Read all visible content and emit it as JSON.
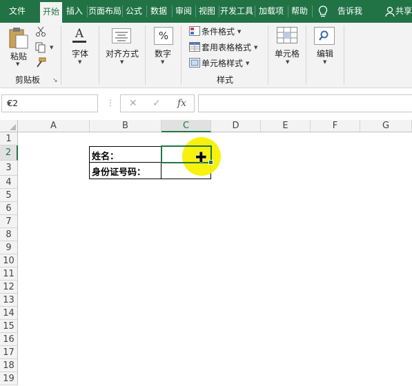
{
  "ribbon_tabs": [
    "文件",
    "开始",
    "插入",
    "页面布局",
    "公式",
    "数据",
    "审阅",
    "视图",
    "开发工具",
    "加载项",
    "帮助"
  ],
  "active_tab": "开始",
  "tell_me": "告诉我",
  "share": "共享",
  "clipboard": {
    "paste": "粘贴",
    "group": "剪贴板"
  },
  "font": {
    "label": "字体"
  },
  "alignment": {
    "label": "对齐方式"
  },
  "number": {
    "label": "数字"
  },
  "styles": {
    "conditional": "条件格式",
    "table": "套用表格格式",
    "cell": "单元格样式",
    "group": "样式"
  },
  "cells": {
    "label": "单元格"
  },
  "editing": {
    "label": "编辑"
  },
  "name_box": "C2",
  "formula_value": "",
  "columns": [
    "A",
    "B",
    "C",
    "D",
    "E",
    "F",
    "G"
  ],
  "rows": [
    "1",
    "2",
    "3",
    "4",
    "5",
    "6",
    "7",
    "8",
    "9",
    "10",
    "11",
    "12",
    "13",
    "14",
    "15",
    "16",
    "17",
    "18",
    "19"
  ],
  "selected_cell": "C2",
  "cells_content": {
    "B2": "姓名：",
    "B3": "身份证号码：",
    "C2": "",
    "C3": ""
  },
  "colors": {
    "accent": "#217346",
    "highlight": "#f5f000"
  }
}
